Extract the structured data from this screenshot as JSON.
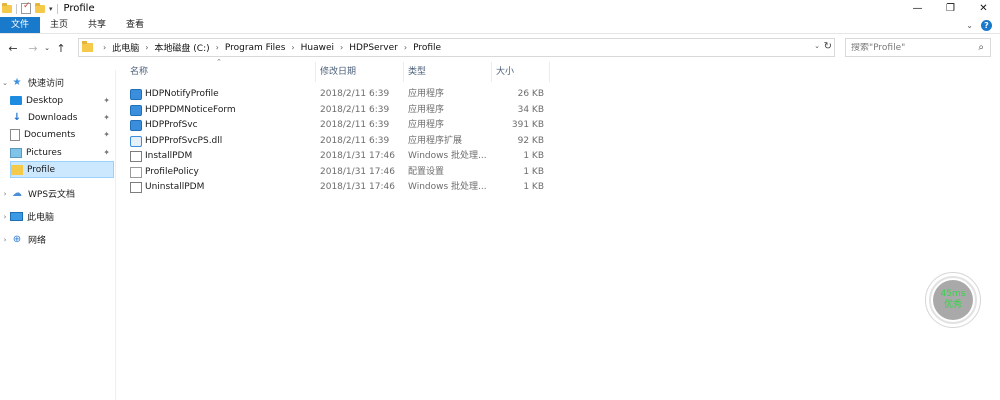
{
  "window": {
    "title": "Profile",
    "controls": {
      "minimize": "—",
      "maximize": "❐",
      "close": "✕"
    }
  },
  "ribbon": {
    "tabs": [
      "文件",
      "主页",
      "共享",
      "查看"
    ]
  },
  "address": {
    "breadcrumbs": [
      "此电脑",
      "本地磁盘 (C:)",
      "Program Files",
      "Huawei",
      "HDPServer",
      "Profile"
    ]
  },
  "search": {
    "placeholder": "搜索\"Profile\""
  },
  "sidebar": {
    "quick_access": "快速访问",
    "items": [
      {
        "label": "Desktop",
        "icon": "desktop-icon",
        "pinned": true
      },
      {
        "label": "Downloads",
        "icon": "download-icon",
        "pinned": true
      },
      {
        "label": "Documents",
        "icon": "document-icon",
        "pinned": true
      },
      {
        "label": "Pictures",
        "icon": "picture-icon",
        "pinned": true
      },
      {
        "label": "Profile",
        "icon": "folder-icon",
        "pinned": false,
        "selected": true
      }
    ],
    "wps": "WPS云文档",
    "this_pc": "此电脑",
    "network": "网络"
  },
  "columns": {
    "name": "名称",
    "date": "修改日期",
    "type": "类型",
    "size": "大小"
  },
  "files": [
    {
      "name": "HDPNotifyProfile",
      "date": "2018/2/11 6:39",
      "type": "应用程序",
      "size": "26 KB",
      "icon": "app"
    },
    {
      "name": "HDPPDMNoticeForm",
      "date": "2018/2/11 6:39",
      "type": "应用程序",
      "size": "34 KB",
      "icon": "app"
    },
    {
      "name": "HDPProfSvc",
      "date": "2018/2/11 6:39",
      "type": "应用程序",
      "size": "391 KB",
      "icon": "app"
    },
    {
      "name": "HDPProfSvcPS.dll",
      "date": "2018/2/11 6:39",
      "type": "应用程序扩展",
      "size": "92 KB",
      "icon": "dll"
    },
    {
      "name": "InstallPDM",
      "date": "2018/1/31 17:46",
      "type": "Windows 批处理...",
      "size": "1 KB",
      "icon": "bat"
    },
    {
      "name": "ProfilePolicy",
      "date": "2018/1/31 17:46",
      "type": "配置设置",
      "size": "1 KB",
      "icon": "ini"
    },
    {
      "name": "UninstallPDM",
      "date": "2018/1/31 17:46",
      "type": "Windows 批处理...",
      "size": "1 KB",
      "icon": "bat"
    }
  ],
  "latency": {
    "value": "45ms",
    "quality": "优秀",
    "color": "#39d24a"
  }
}
